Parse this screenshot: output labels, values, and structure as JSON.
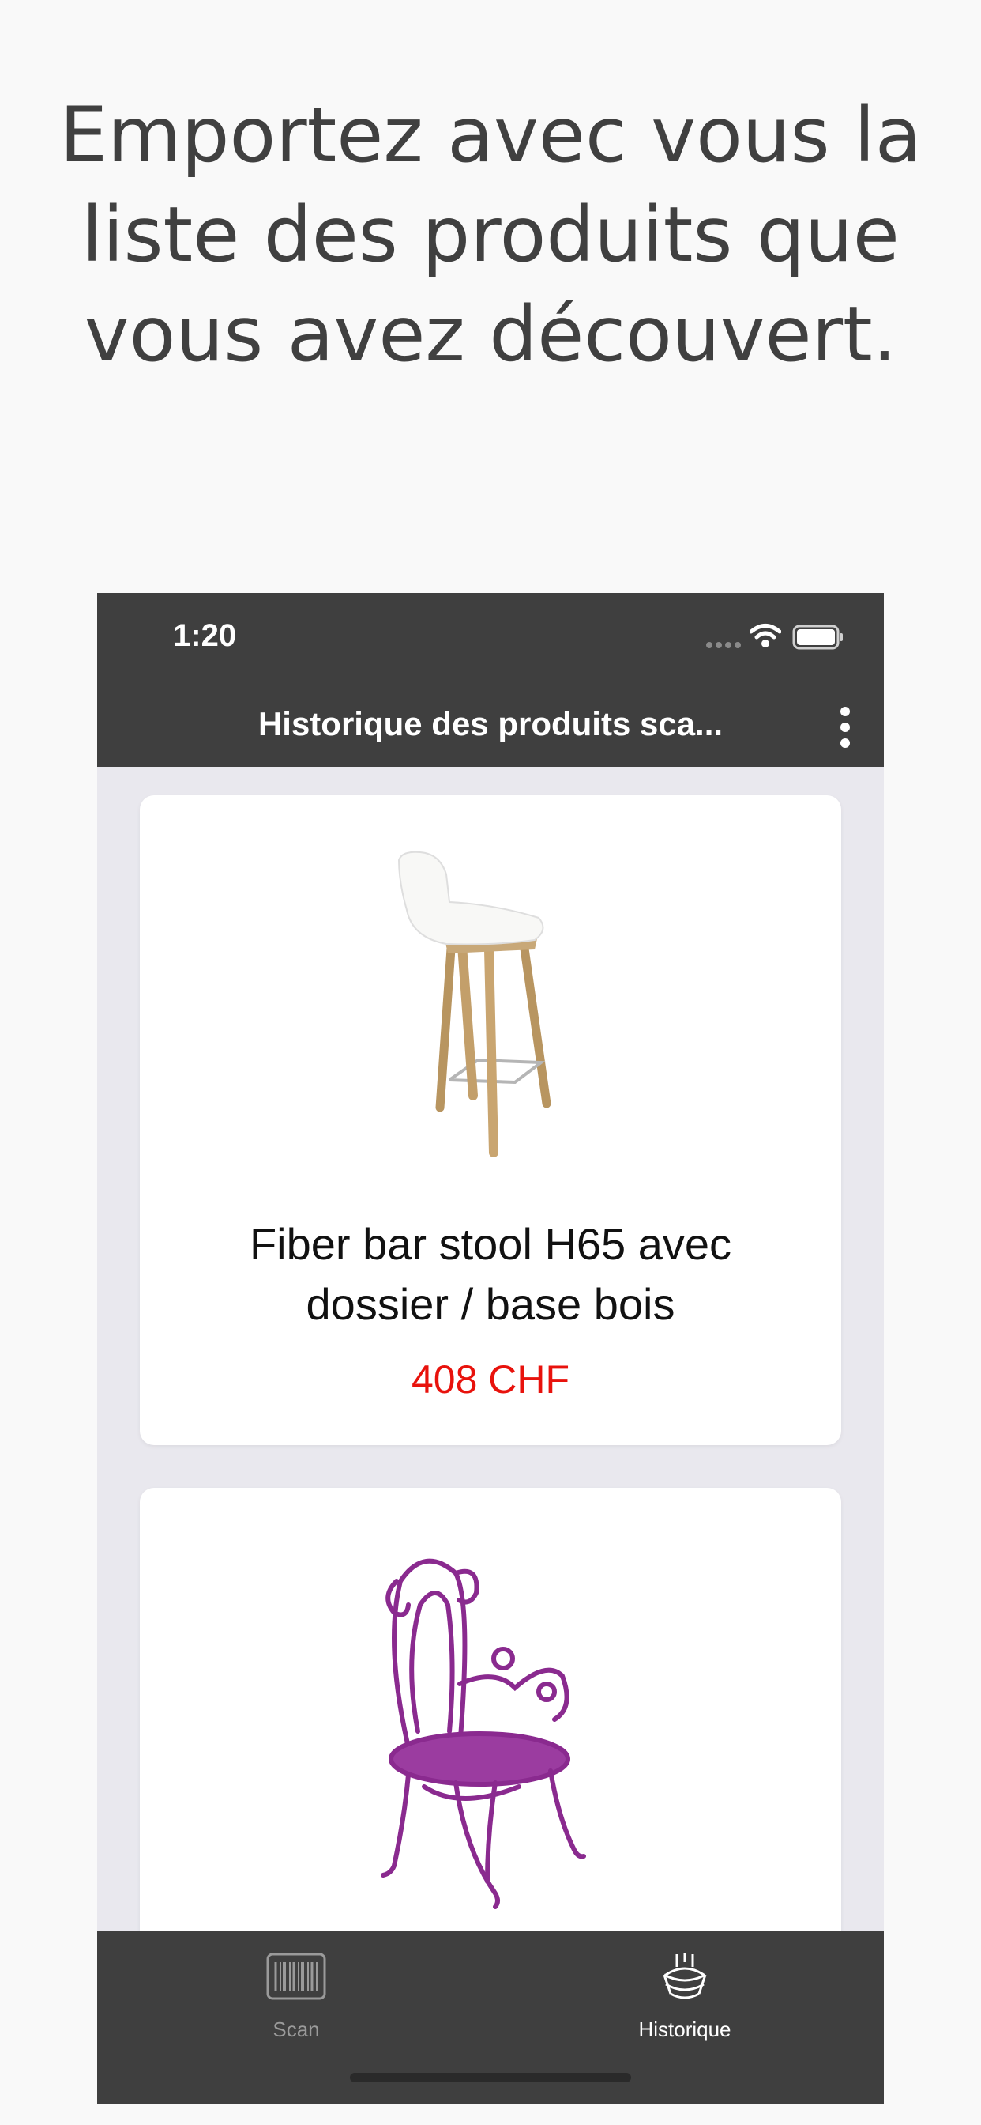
{
  "headline": {
    "line1": "Emportez avec vous la",
    "line2": "liste des produits que",
    "line3": "vous avez découvert."
  },
  "status_bar": {
    "time": "1:20",
    "icons": [
      "signal-icon",
      "wifi-icon",
      "battery-icon"
    ]
  },
  "nav": {
    "title": "Historique des produits sca...",
    "menu_icon": "more-vertical-icon"
  },
  "products": [
    {
      "title_line1": "Fiber bar stool H65 avec",
      "title_line2": "dossier / base bois",
      "price": "408 CHF",
      "image_icon": "bar-stool-image"
    },
    {
      "image_icon": "purple-chair-image"
    }
  ],
  "tabs": [
    {
      "label": "Scan",
      "icon": "barcode-icon",
      "active": false
    },
    {
      "label": "Historique",
      "icon": "lamp-icon",
      "active": true
    }
  ],
  "colors": {
    "bar_background": "#3f3f3f",
    "price": "#e8120c",
    "list_background": "#e9e8ee",
    "chair_purple": "#8a2a8f",
    "tab_inactive": "#9a9a9a",
    "tab_active": "#ffffff"
  }
}
